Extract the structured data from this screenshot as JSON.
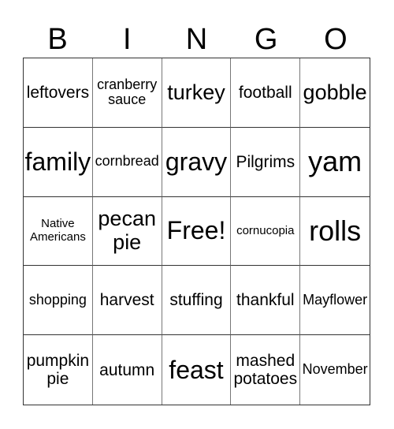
{
  "header": {
    "letters": [
      "B",
      "I",
      "N",
      "G",
      "O"
    ]
  },
  "cells": [
    "leftovers",
    "cranberry sauce",
    "turkey",
    "football",
    "gobble",
    "family",
    "cornbread",
    "gravy",
    "Pilgrims",
    "yam",
    "Native Americans",
    "pecan pie",
    "Free!",
    "cornucopia",
    "rolls",
    "shopping",
    "harvest",
    "stuffing",
    "thankful",
    "Mayflower",
    "pumpkin pie",
    "autumn",
    "feast",
    "mashed potatoes",
    "November"
  ]
}
